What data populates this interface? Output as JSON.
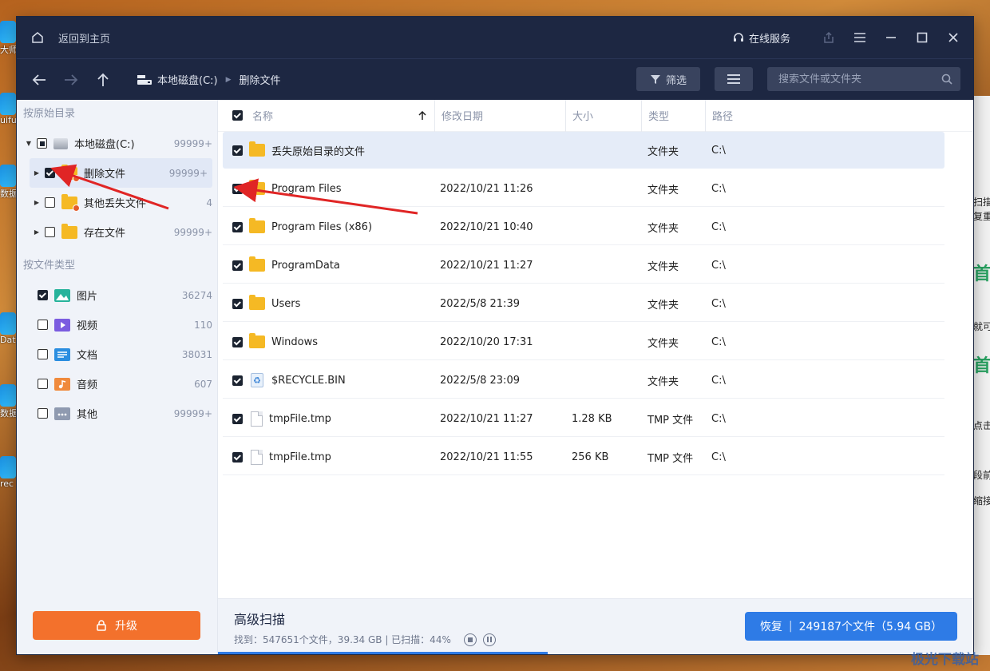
{
  "window": {
    "home_label": "返回到主页",
    "service_label": "在线服务"
  },
  "nav": {
    "crumbs": [
      "本地磁盘(C:)",
      "删除文件"
    ],
    "filter_label": "筛选",
    "search_placeholder": "搜索文件或文件夹"
  },
  "sidebar": {
    "section_dir": "按原始目录",
    "tree": [
      {
        "label": "本地磁盘(C:)",
        "count": "99999+"
      },
      {
        "label": "删除文件",
        "count": "99999+"
      },
      {
        "label": "其他丢失文件",
        "count": "4"
      },
      {
        "label": "存在文件",
        "count": "99999+"
      }
    ],
    "section_type": "按文件类型",
    "types": [
      {
        "label": "图片",
        "count": "36274",
        "icon": "image-icon",
        "checked": true
      },
      {
        "label": "视频",
        "count": "110",
        "icon": "video-icon",
        "checked": false
      },
      {
        "label": "文档",
        "count": "38031",
        "icon": "document-icon",
        "checked": false
      },
      {
        "label": "音频",
        "count": "607",
        "icon": "audio-icon",
        "checked": false
      },
      {
        "label": "其他",
        "count": "99999+",
        "icon": "other-icon",
        "checked": false
      }
    ],
    "upgrade_label": "升级"
  },
  "table": {
    "columns": [
      "名称",
      "修改日期",
      "大小",
      "类型",
      "路径"
    ],
    "rows": [
      {
        "name": "丢失原始目录的文件",
        "date": "",
        "size": "",
        "type": "文件夹",
        "path": "C:\\",
        "icon": "folder-icon"
      },
      {
        "name": "Program Files",
        "date": "2022/10/21 11:26",
        "size": "",
        "type": "文件夹",
        "path": "C:\\",
        "icon": "folder-icon"
      },
      {
        "name": "Program Files (x86)",
        "date": "2022/10/21 10:40",
        "size": "",
        "type": "文件夹",
        "path": "C:\\",
        "icon": "folder-icon"
      },
      {
        "name": "ProgramData",
        "date": "2022/10/21 11:27",
        "size": "",
        "type": "文件夹",
        "path": "C:\\",
        "icon": "folder-icon"
      },
      {
        "name": "Users",
        "date": "2022/5/8 21:39",
        "size": "",
        "type": "文件夹",
        "path": "C:\\",
        "icon": "folder-icon"
      },
      {
        "name": "Windows",
        "date": "2022/10/20 17:31",
        "size": "",
        "type": "文件夹",
        "path": "C:\\",
        "icon": "folder-icon"
      },
      {
        "name": "$RECYCLE.BIN",
        "date": "2022/5/8 23:09",
        "size": "",
        "type": "文件夹",
        "path": "C:\\",
        "icon": "recycle-icon"
      },
      {
        "name": "tmpFile.tmp",
        "date": "2022/10/21 11:27",
        "size": "1.28 KB",
        "type": "TMP 文件",
        "path": "C:\\",
        "icon": "file-icon"
      },
      {
        "name": "tmpFile.tmp",
        "date": "2022/10/21 11:55",
        "size": "256 KB",
        "type": "TMP 文件",
        "path": "C:\\",
        "icon": "file-icon"
      }
    ]
  },
  "status": {
    "title": "高级扫描",
    "found_text": "找到：547651个文件，39.34 GB | 已扫描：44%",
    "progress_percent": 44,
    "recover_label": "恢复",
    "recover_info": "249187个文件（5.94 GB）"
  },
  "desktop": {
    "icons": [
      "大师",
      "uifu",
      "数据",
      "Dat",
      "数据",
      "rec"
    ]
  },
  "background_window": {
    "texts": [
      "扫描",
      "复重",
      "就可",
      "点击",
      "段前",
      "缩接"
    ]
  },
  "watermark": "极光下载站"
}
